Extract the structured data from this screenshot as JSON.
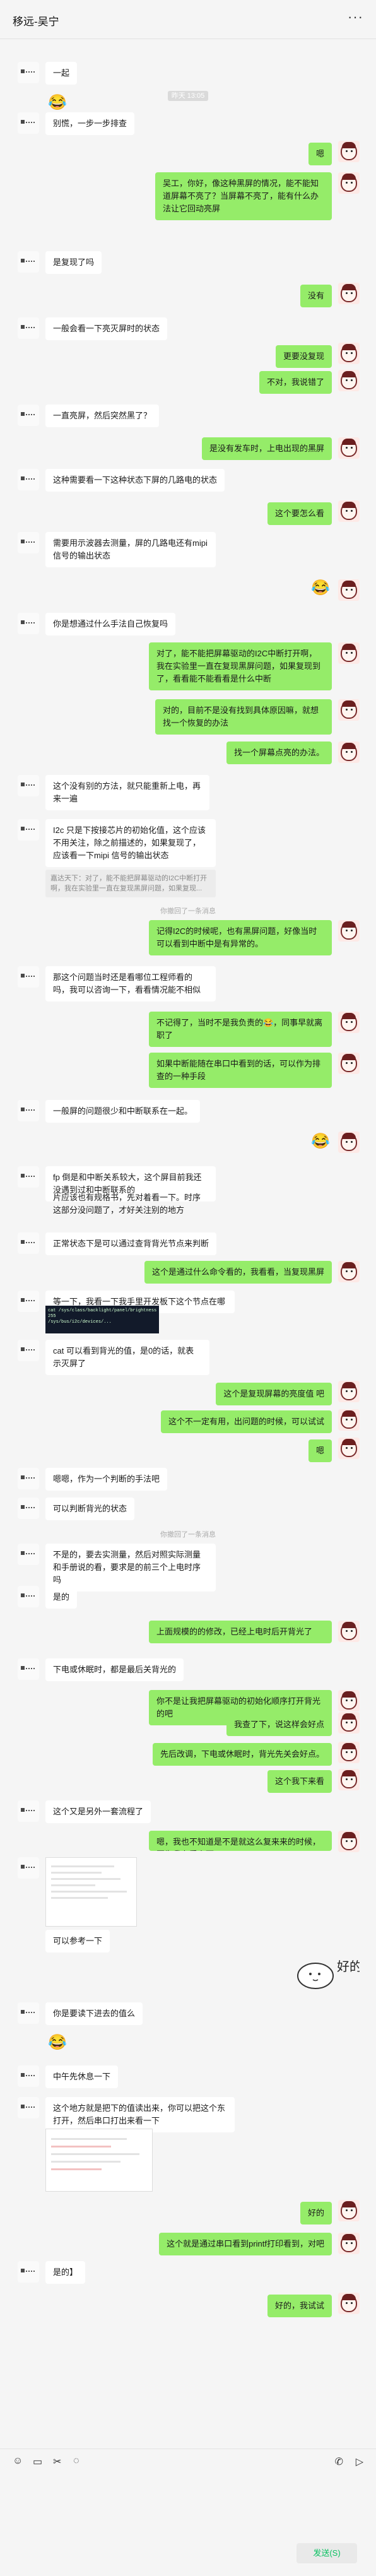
{
  "window": {
    "title": "移远-吴宁",
    "more_icon": "more-icon"
  },
  "messages": {
    "m1": "一起",
    "m2": "别慌，一步一步排查",
    "m3": "嗯",
    "m4": "吴工，你好，像这种黑屏的情况，能不能知道屏幕不亮了？当屏幕不亮了，能有什么办法让它回动亮屏",
    "m5": "是复现了吗",
    "m6": "没有",
    "m7": "一般会看一下亮灭屏时的状态",
    "m8": "更要没复现",
    "m9": "不对，我说错了",
    "m10": "一直亮屏，然后突然黑了？",
    "m11": "是没有发车时，上电出现的黑屏",
    "m12": "这种需要看一下这种状态下屏的几路电的状态",
    "m13": "这个要怎么看",
    "m14": "需要用示波器去测量，屏的几路电还有mipi 信号的输出状态",
    "m15": "你是想通过什么手法自己恢复吗",
    "m16": "对了，能不能把屏幕驱动的I2C中断打开啊，我在实验里一直在复现黑屏问题，如果复现到了，看看能不能看看是什么中断",
    "m17": "对的，目前不是没有找到具体原因嘛，就想找一个恢复的办法",
    "m18": "找一个屏幕点亮的办法。",
    "m19": "这个没有别的方法，就只能重新上电，再来一遍",
    "m20": "I2c 只是下按接芯片的初始化值，这个应该不用关注，除之前描述的，如果复现了，应该看一下mipi 信号的输出状态",
    "quote1": "嘉达天下：对了，能不能把屏幕驱动的I2C中断打开啊，我在实验里一直在复现黑屏问题，如果复现...",
    "time1": "你撤回了一条消息",
    "m21": "记得I2C的时候呢，也有黑屏问题，好像当时可以看到中断中是有异常的。",
    "m22": "那这个问题当时还是看哪位工程师看的吗，我可以咨询一下，看看情况能不相似",
    "m23": "不记得了，当时不是我负责的😂，同事早就离职了",
    "m24": "如果中断能随在串口中看到的话，可以作为排查的一种手段",
    "m25": "一般屏的问题很少和中断联系在一起。",
    "m26": "fp 倒是和中断关系较大，这个屏目前我还没遇到过和中断联系的",
    "m26b": "片应该也有规格书，先对着看一下。时序这部分没问题了，才好关注别的地方",
    "m27": "正常状态下是可以通过查背背光节点来判断",
    "m28": "这个是通过什么命令看的，我看看，当复现黑屏",
    "m29": "等一下，我看一下我手里开发板下这个节点在哪",
    "terminal": "cat /sys/class/backlight/panel/brightness\n255\n/sys/bus/i2c/devices/...",
    "m30": "cat 可以看到背光的值，是0的话，就表示灭屏了",
    "m31": "这个是复现屏幕的亮度值 吧",
    "m32": "这个不一定有用，出问题的时候，可以试试",
    "m33": "嗯",
    "m34": "嗯嗯，作为一个判断的手法吧",
    "m35": "可以判断背光的状态",
    "time2": "你撤回了一条消息",
    "m36": "不是的，要去实测量，然后对照实际测量和手册说的看，要求是的前三个上电时序吗",
    "m37": "是的",
    "m38": "上面规模的的修改，已经上电时后开背光了",
    "m39": "下电或休眠时，都是最后关背光的",
    "m40": "你不是让我把屏幕驱动的初始化顺序打开背光的吧",
    "m41": "我查了下，说这样会好点",
    "m42": "先后改调，下电或休眠时，背光先关会好点。",
    "m43": "这个我下来看",
    "m44": "这个又是另外一套流程了",
    "m45": "嗯，我也不知道是不是就这么复来来的时候，因为我在看上面...",
    "m46": "可以参考一下",
    "m47": "你是要读下进去的值么",
    "m48": "中午先休息一下",
    "m49": "这个地方就是把下的值读出来，你可以把这个东打开，然后串口打出来看一下",
    "m50": "好的",
    "m51": "这个就是通过串口看到printf打印看到，对吧",
    "m52": "是的】",
    "m53": "好的，我试试"
  },
  "toolbar": {
    "icons": [
      "emoji-icon",
      "folder-icon",
      "scissors-icon",
      "chat-history-icon",
      "phone-icon",
      "video-icon"
    ],
    "send_label": "发送(S)"
  }
}
